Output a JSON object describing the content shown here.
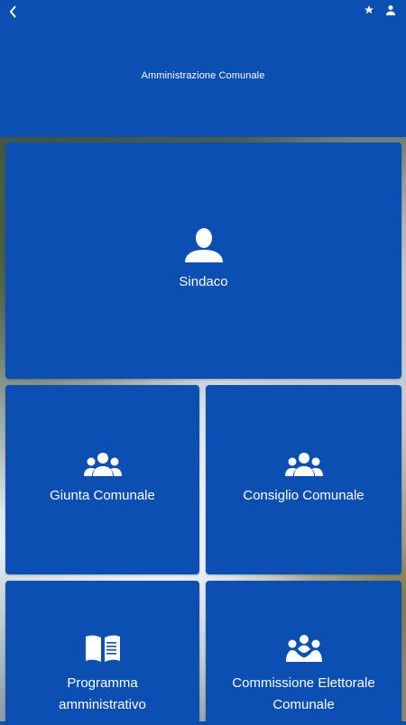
{
  "header": {
    "title": "Amministrazione Comunale",
    "icons": {
      "back": "back-chevron-icon",
      "favorite": "star-icon",
      "account": "user-icon"
    }
  },
  "tiles": [
    {
      "label": "Sindaco",
      "icon": "person-icon"
    },
    {
      "label": "Giunta Comunale",
      "icon": "group-icon"
    },
    {
      "label": "Consiglio Comunale",
      "icon": "group-icon"
    },
    {
      "label_line1": "Programma",
      "label_line2": "amministrativo",
      "icon": "book-icon"
    },
    {
      "label_line1": "Commissione Elettorale",
      "label_line2": "Comunale",
      "icon": "handshake-group-icon"
    }
  ],
  "colors": {
    "primary": "#0b4fb3",
    "text": "#ffffff"
  }
}
